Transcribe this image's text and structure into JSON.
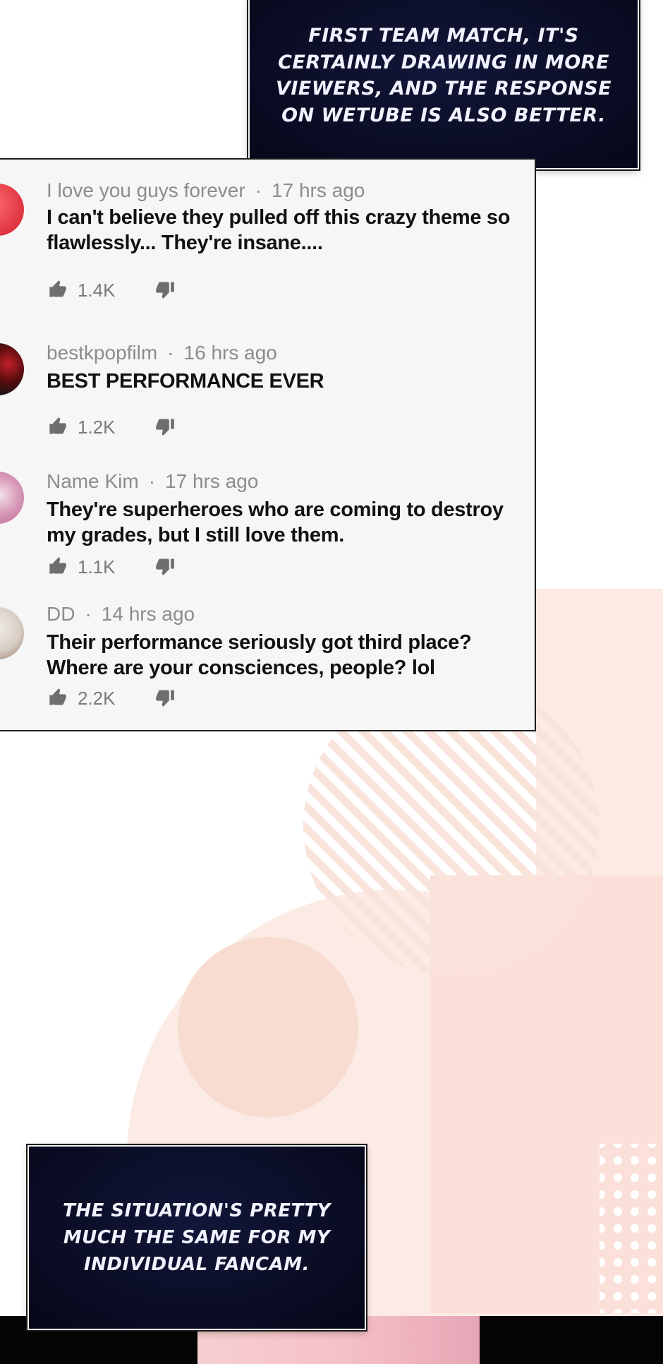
{
  "captions": {
    "top": "FIRST TEAM MATCH, IT'S CERTAINLY DRAWING IN MORE VIEWERS, AND THE RESPONSE ON WETUBE IS ALSO BETTER.",
    "bottom": "THE SITUATION'S PRETTY MUCH THE SAME FOR MY INDIVIDUAL FANCAM."
  },
  "comments": [
    {
      "user": "I love you guys forever",
      "separator": "·",
      "time": "17 hrs ago",
      "text": "I can't believe they pulled off this crazy theme so flawlessly... They're insane....",
      "likes": "1.4K",
      "avatar_color": "#e8404a"
    },
    {
      "user": "bestkpopfilm",
      "separator": "·",
      "time": "16 hrs ago",
      "text": "BEST PERFORMANCE EVER",
      "likes": "1.2K",
      "avatar_color": "#2a0d0d"
    },
    {
      "user": "Name Kim",
      "separator": "·",
      "time": "17 hrs ago",
      "text": "They're superheroes who are coming to destroy my grades, but I still love them.",
      "likes": "1.1K",
      "avatar_color": "#c97aa6"
    },
    {
      "user": "DD",
      "separator": "·",
      "time": "14 hrs ago",
      "text": "Their performance seriously got third place? Where are your consciences, people? lol",
      "likes": "2.2K",
      "avatar_color": "#cfc6bd"
    }
  ],
  "icons": {
    "like": "thumbs-up-icon",
    "dislike": "thumbs-down-icon"
  },
  "colors": {
    "caption_bg": "#0a0d24",
    "panel_bg": "#f6f6f6",
    "background_art": "#fbe3dc"
  }
}
